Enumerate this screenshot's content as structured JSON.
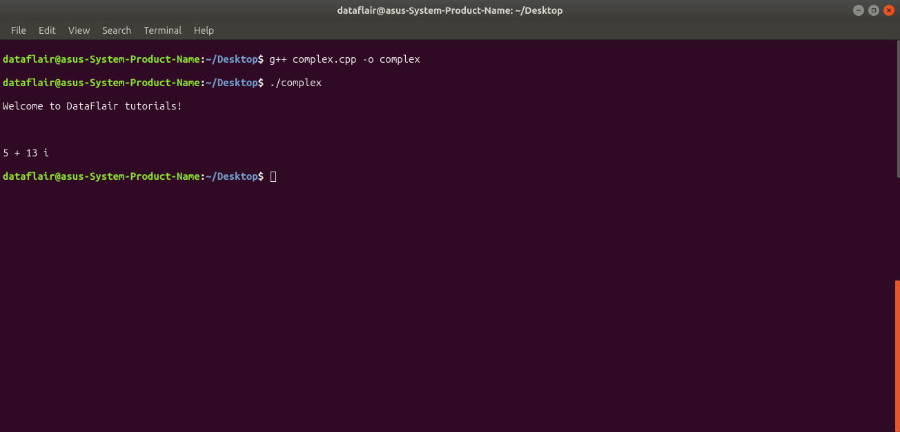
{
  "window": {
    "title": "dataflair@asus-System-Product-Name: ~/Desktop"
  },
  "menu": {
    "file": "File",
    "edit": "Edit",
    "view": "View",
    "search": "Search",
    "terminal": "Terminal",
    "help": "Help"
  },
  "prompt": {
    "user_host": "dataflair@asus-System-Product-Name",
    "colon": ":",
    "path_tilde": "~",
    "path_dir": "/Desktop",
    "dollar": "$"
  },
  "lines": {
    "cmd1": " g++ complex.cpp -o complex",
    "cmd2": " ./complex",
    "out1": "Welcome to DataFlair tutorials!",
    "out2": "5 + 13 i",
    "cmd3": " "
  }
}
